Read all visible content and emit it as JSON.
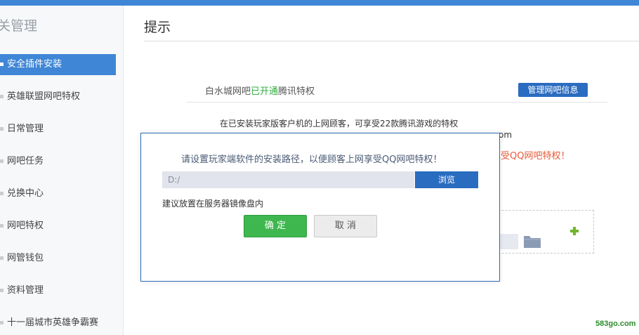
{
  "sidebar": {
    "title": "关管理",
    "items": [
      {
        "label": "安全插件安装",
        "active": true
      },
      {
        "label": "英雄联盟网吧特权"
      },
      {
        "label": "日常管理"
      },
      {
        "label": "网吧任务"
      },
      {
        "label": "兑换中心"
      },
      {
        "label": "网吧特权"
      },
      {
        "label": "网管钱包"
      },
      {
        "label": "资料管理"
      },
      {
        "label": "十一届城市英雄争霸赛"
      }
    ]
  },
  "main": {
    "title": "提示",
    "status": {
      "prefix": "白水城网吧",
      "highlight": "已开通",
      "suffix": "腾讯特权"
    },
    "manage_button": "管理网吧信息",
    "description_line1": "在已安装玩家版客户机的上网顾客，可享受22款腾讯游戏的特权",
    "description_tail": "om",
    "red_text": "享受QQ网吧特权！"
  },
  "dialog": {
    "message": "请设置玩家端软件的安装路径，以便顾客上网享受QQ网吧特权！",
    "path_placeholder": "D:/",
    "browse_label": "浏览",
    "hint": "建议放置在服务器镜像盘内",
    "ok_label": "确 定",
    "cancel_label": "取 消"
  },
  "icons": {
    "folder": "folder-icon",
    "add": "plus-icon"
  },
  "colors": {
    "accent": "#3f86d6",
    "primary_button": "#2a6cc0",
    "ok_button": "#3fb74f",
    "highlight_green": "#2fae3f",
    "warning_red": "#e85b3a"
  },
  "watermark": "583go.com"
}
